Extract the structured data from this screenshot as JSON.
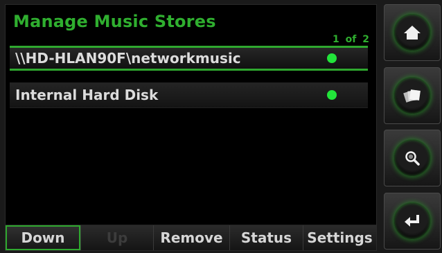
{
  "header": {
    "title": "Manage Music Stores",
    "pager": "1 of 2"
  },
  "stores": [
    {
      "label": "\\\\HD-HLAN90F\\networkmusic",
      "status_color": "#22e43a",
      "selected": true
    },
    {
      "label": "Internal Hard Disk",
      "status_color": "#22e43a",
      "selected": false
    }
  ],
  "toolbar": {
    "down": "Down",
    "up": "Up",
    "remove": "Remove",
    "status": "Status",
    "settings": "Settings"
  },
  "side_buttons": [
    "home-icon",
    "albums-icon",
    "search-icon",
    "enter-icon"
  ],
  "colors": {
    "accent": "#2fae2f",
    "status_ok": "#22e43a"
  }
}
